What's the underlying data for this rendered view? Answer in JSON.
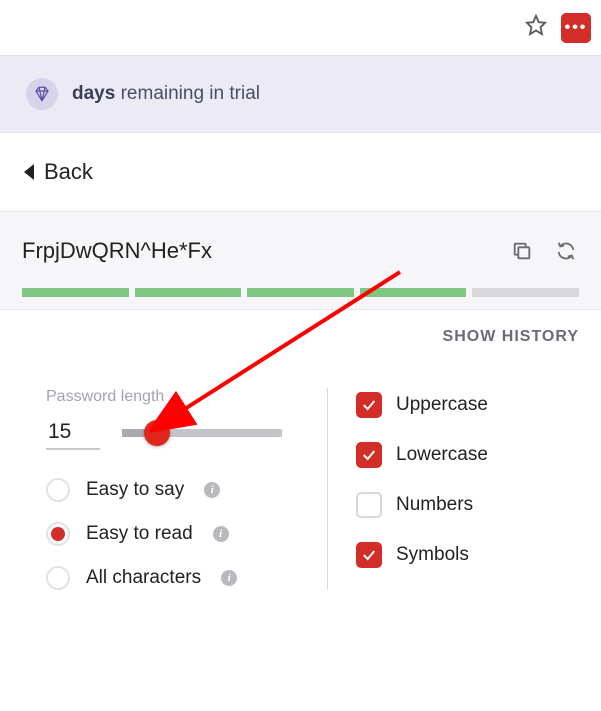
{
  "browser": {
    "ext_glyph": "•••"
  },
  "trial": {
    "days": "days",
    "remaining": "remaining in trial"
  },
  "nav": {
    "back": "Back"
  },
  "password": {
    "value": "FrpjDwQRN^He*Fx",
    "strength_filled": 4,
    "strength_total": 5,
    "show_history": "SHOW HISTORY"
  },
  "length": {
    "label": "Password length",
    "value": "15",
    "slider_percent": 22
  },
  "modes": {
    "items": [
      {
        "label": "Easy to say",
        "selected": false,
        "info": true
      },
      {
        "label": "Easy to read",
        "selected": true,
        "info": true
      },
      {
        "label": "All characters",
        "selected": false,
        "info": true
      }
    ]
  },
  "chars": {
    "items": [
      {
        "label": "Uppercase",
        "checked": true
      },
      {
        "label": "Lowercase",
        "checked": true
      },
      {
        "label": "Numbers",
        "checked": false
      },
      {
        "label": "Symbols",
        "checked": true
      }
    ]
  }
}
